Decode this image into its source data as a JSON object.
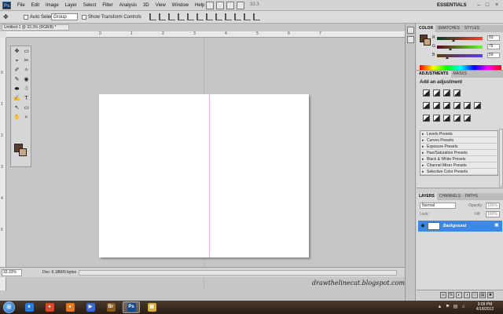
{
  "app": {
    "logo_text": "Ps",
    "menu": [
      "File",
      "Edit",
      "Image",
      "Layer",
      "Select",
      "Filter",
      "Analysis",
      "3D",
      "View",
      "Window",
      "Help"
    ],
    "zoom_readout": "33.3",
    "workspace": "ESSENTIALS",
    "window_controls": {
      "minimize": "–",
      "maximize": "□",
      "close": "×"
    }
  },
  "options_bar": {
    "tool_icon": "move-tool-icon",
    "auto_select_label": "Auto Select:",
    "auto_select_value": "Group",
    "transform_label": "Show Transform Controls"
  },
  "document": {
    "tab_title": "Untitled-1 @ 33.3% (RGB/8) *",
    "ruler_top_numbers": [
      "0",
      "1",
      "2",
      "3",
      "4",
      "5",
      "6",
      "7"
    ],
    "ruler_left_numbers": [
      "0",
      "1",
      "2",
      "3",
      "4",
      "5"
    ],
    "watermark": "drawthelinecat.blogspot.com",
    "zoom_field": "33.33%",
    "doc_size": "Doc: 6.18M/0 bytes"
  },
  "toolbox": {
    "tools": [
      "✥",
      "▭",
      "⌖",
      "✂",
      "✐",
      "✧",
      "✎",
      "◉",
      "⬬",
      "☃",
      "✍",
      "T",
      "↖",
      "▭",
      "✋",
      "⌕"
    ],
    "foreground_color": "#5c3c26",
    "background_color": "#c8a882"
  },
  "color_panel": {
    "tabs": [
      "COLOR",
      "SWATCHES",
      "STYLES"
    ],
    "channels": [
      {
        "label": "R",
        "value": "93",
        "position": 0.36
      },
      {
        "label": "G",
        "value": "76",
        "position": 0.3
      },
      {
        "label": "B",
        "value": "59",
        "position": 0.23
      }
    ]
  },
  "adjustments_panel": {
    "tabs": [
      "ADJUSTMENTS",
      "MASKS"
    ],
    "title": "Add an adjustment",
    "presets": [
      "Levels Presets",
      "Curves Presets",
      "Exposure Presets",
      "Hue/Saturation Presets",
      "Black & White Presets",
      "Channel Mixer Presets",
      "Selective Color Presets"
    ]
  },
  "layers_panel": {
    "tabs": [
      "LAYERS",
      "CHANNELS",
      "PATHS"
    ],
    "blend_mode": "Normal",
    "opacity_label": "Opacity:",
    "opacity_value": "100%",
    "lock_label": "Lock:",
    "fill_label": "Fill:",
    "fill_value": "100%",
    "layers": [
      {
        "name": "Background",
        "selected": true
      }
    ],
    "bottom_icons": [
      "∞",
      "fx",
      "◐",
      "◑",
      "□",
      "▤",
      "✖"
    ]
  },
  "taskbar": {
    "start_glyph": "⊞",
    "apps": [
      {
        "name": "ie",
        "glyph": "e",
        "color": "#2a7ad8"
      },
      {
        "name": "chrome",
        "glyph": "●",
        "color": "#d94a2a"
      },
      {
        "name": "firefox",
        "glyph": "●",
        "color": "#e07a20"
      },
      {
        "name": "media",
        "glyph": "▶",
        "color": "#3a6ad0"
      },
      {
        "name": "bridge",
        "glyph": "Br",
        "color": "#8a5a20"
      },
      {
        "name": "photoshop",
        "glyph": "Ps",
        "color": "#1a4a8a",
        "active": true
      },
      {
        "name": "explorer",
        "glyph": "▤",
        "color": "#d8b040"
      }
    ],
    "time": "9:09 PM",
    "date": "4/18/2012"
  }
}
